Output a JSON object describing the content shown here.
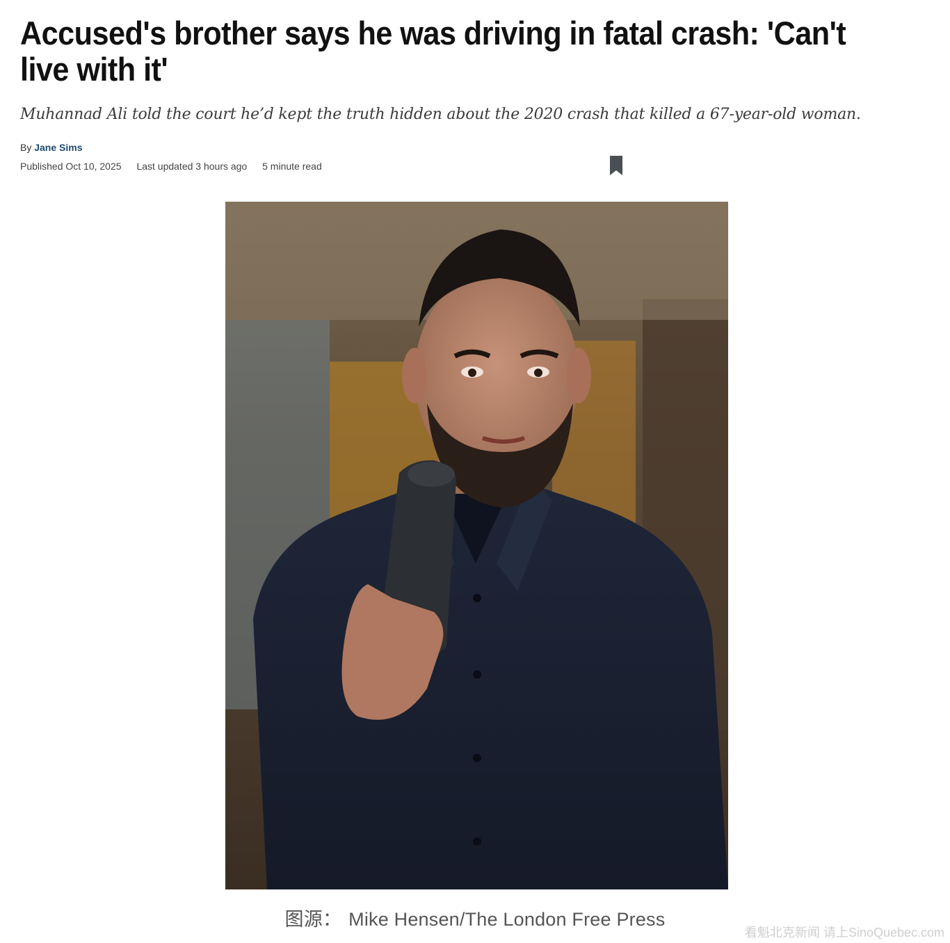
{
  "article": {
    "headline": "Accused's brother says he was driving in fatal crash: 'Can't live with it'",
    "dek": "Muhannad Ali told the court he’d kept the truth hidden about the 2020 crash that killed a 67-year-old woman.",
    "byline_prefix": "By",
    "author": "Jane Sims",
    "published": "Published Oct 10, 2025",
    "last_updated": "Last updated 3 hours ago",
    "read_time": "5 minute read",
    "bookmark_icon": "bookmark-icon"
  },
  "photo": {
    "description_icon": "portrait-photo",
    "credit_prefix": "图源：",
    "credit": "Mike Hensen/The London Free Press"
  },
  "watermark": {
    "text": "看魁北克新闻 请上SinoQuebec.com"
  },
  "colors": {
    "author_link": "#1f4a6e",
    "bookmark": "#4a4f55",
    "credit_text": "#555555"
  }
}
